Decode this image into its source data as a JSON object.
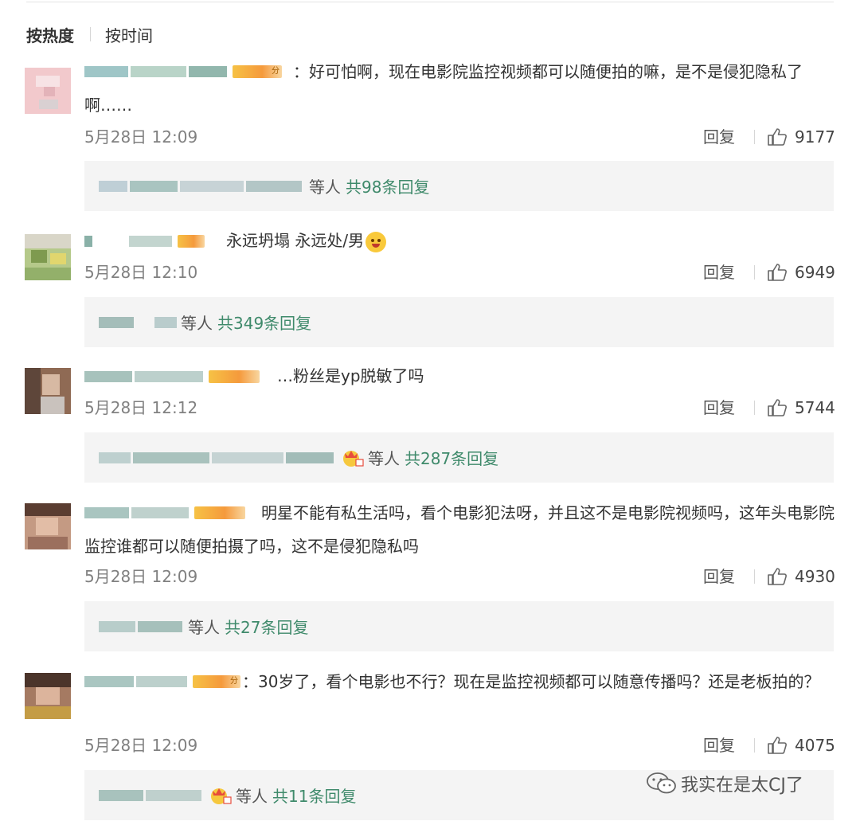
{
  "sort": {
    "hot_label": "按热度",
    "time_label": "按时间"
  },
  "reply_label": "回复",
  "comments": [
    {
      "text": "：好可怕啊，现在电影院监控视频都可以随便拍的嘛，是不是侵犯隐私了啊……",
      "time": "5月28日 12:09",
      "likes": "9177",
      "reply_people": "等人",
      "reply_link": "共98条回复"
    },
    {
      "text": "永远坍塌 永远处/男",
      "time": "5月28日 12:10",
      "likes": "6949",
      "reply_people": "等人",
      "reply_link": "共349条回复"
    },
    {
      "text": "…粉丝是yp脱敏了吗",
      "time": "5月28日 12:12",
      "likes": "5744",
      "reply_people": "等人",
      "reply_link": "共287条回复"
    },
    {
      "text": "明星不能有私生活吗，看个电影犯法呀，并且这不是电影院视频吗，这年头电影院监控谁都可以随便拍摄了吗，这不是侵犯隐私吗",
      "time": "5月28日 12:09",
      "likes": "4930",
      "reply_people": "等人",
      "reply_link": "共27条回复"
    },
    {
      "text": "：30岁了，看个电影也不行？现在是监控视频都可以随意传播吗？还是老板拍的？",
      "time": "5月28日 12:09",
      "likes": "4075",
      "reply_people": "等人",
      "reply_link": "共11条回复"
    }
  ],
  "watermark": "我实在是太CJ了",
  "badge_suffix": "分",
  "colors": {
    "link": "#3f8a6b",
    "reply_bg": "#f4f4f4",
    "meta": "#808080"
  },
  "icons": [
    "like-icon",
    "grin-emoji-icon",
    "crown-emoji-icon",
    "wechat-icon"
  ]
}
